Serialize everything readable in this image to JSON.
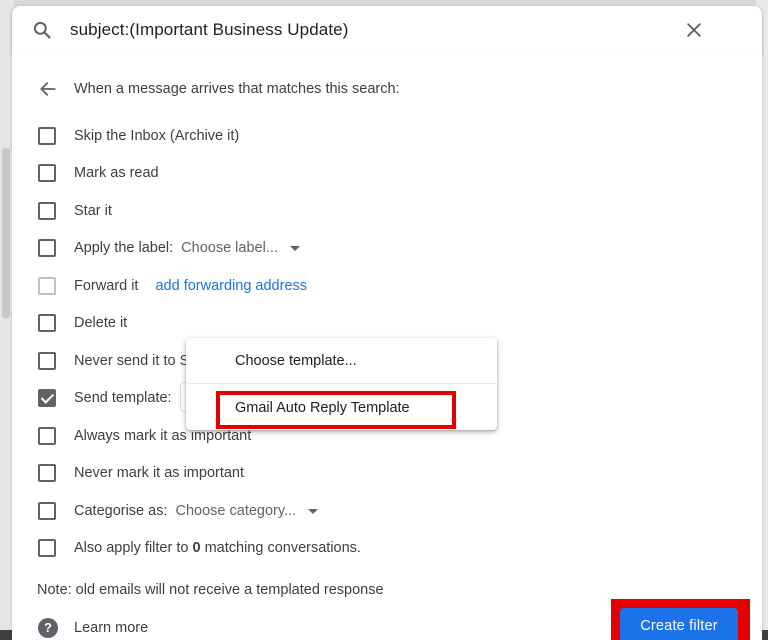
{
  "search": {
    "query": "subject:(Important Business Update)",
    "search_icon": "search-icon",
    "close_icon": "close-icon"
  },
  "filter": {
    "header_text": "When a message arrives that matches this search:",
    "options": [
      {
        "key": "skip_inbox",
        "label": "Skip the Inbox (Archive it)",
        "checked": false
      },
      {
        "key": "mark_read",
        "label": "Mark as read",
        "checked": false
      },
      {
        "key": "star",
        "label": "Star it",
        "checked": false
      },
      {
        "key": "apply_label",
        "label": "Apply the label:",
        "dropdown": "Choose label...",
        "checked": false
      },
      {
        "key": "forward",
        "label": "Forward it",
        "link": "add forwarding address",
        "checked": false,
        "disabled": true
      },
      {
        "key": "delete",
        "label": "Delete it",
        "checked": false
      },
      {
        "key": "never_spam",
        "label": "Never send it to Spam",
        "checked": false
      },
      {
        "key": "send_template",
        "label": "Send template:",
        "checked": true
      },
      {
        "key": "always_important",
        "label": "Always mark it as important",
        "checked": false
      },
      {
        "key": "never_important",
        "label": "Never mark it as important",
        "checked": false
      },
      {
        "key": "categorise",
        "label": "Categorise as:",
        "dropdown": "Choose category...",
        "checked": false
      },
      {
        "key": "also_apply",
        "label_prefix": "Also apply filter to ",
        "count": "0",
        "label_suffix": " matching conversations.",
        "checked": false
      }
    ],
    "note": "Note: old emails will not receive a templated response",
    "learn_more": "Learn more",
    "create_button": "Create filter"
  },
  "template_menu": {
    "items": [
      "Choose template...",
      "Gmail Auto Reply Template"
    ],
    "highlighted_index": 1
  },
  "colors": {
    "accent": "#1a73e8",
    "highlight_red": "#e50000"
  }
}
